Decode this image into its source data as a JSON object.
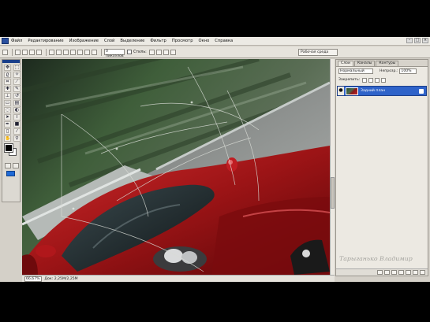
{
  "menu": {
    "items": [
      "Файл",
      "Редактирование",
      "Изображение",
      "Слой",
      "Выделение",
      "Фильтр",
      "Просмотр",
      "Окно",
      "Справка"
    ]
  },
  "options": {
    "feather_label": "0 пикселов",
    "style_label": "Стиль:",
    "workspace_label": "Рабочая среда"
  },
  "tools": {
    "icons": [
      "move-icon",
      "marquee-icon",
      "lasso-icon",
      "magic-wand-icon",
      "crop-icon",
      "slice-icon",
      "healing-icon",
      "brush-icon",
      "stamp-icon",
      "history-brush-icon",
      "eraser-icon",
      "gradient-icon",
      "blur-icon",
      "dodge-icon",
      "path-select-icon",
      "type-icon",
      "pen-icon",
      "shape-icon",
      "notes-icon",
      "eyedropper-icon",
      "hand-icon",
      "zoom-icon"
    ],
    "foreground_color": "#000000",
    "background_color": "#ffffff"
  },
  "status": {
    "zoom": "66,67%",
    "doc_info": "Док: 2,25М/2,25М"
  },
  "layers_panel": {
    "tabs": [
      "Слои",
      "Каналы",
      "Контуры"
    ],
    "active_tab": 0,
    "blend_mode": "Нормальный",
    "opacity_label": "Непрозр.:",
    "opacity_value": "100%",
    "lock_label": "Закрепить:",
    "layer_name": "Задний план",
    "selection_color": "#2f63c9"
  },
  "watermark": "Тарыганько Владимир"
}
